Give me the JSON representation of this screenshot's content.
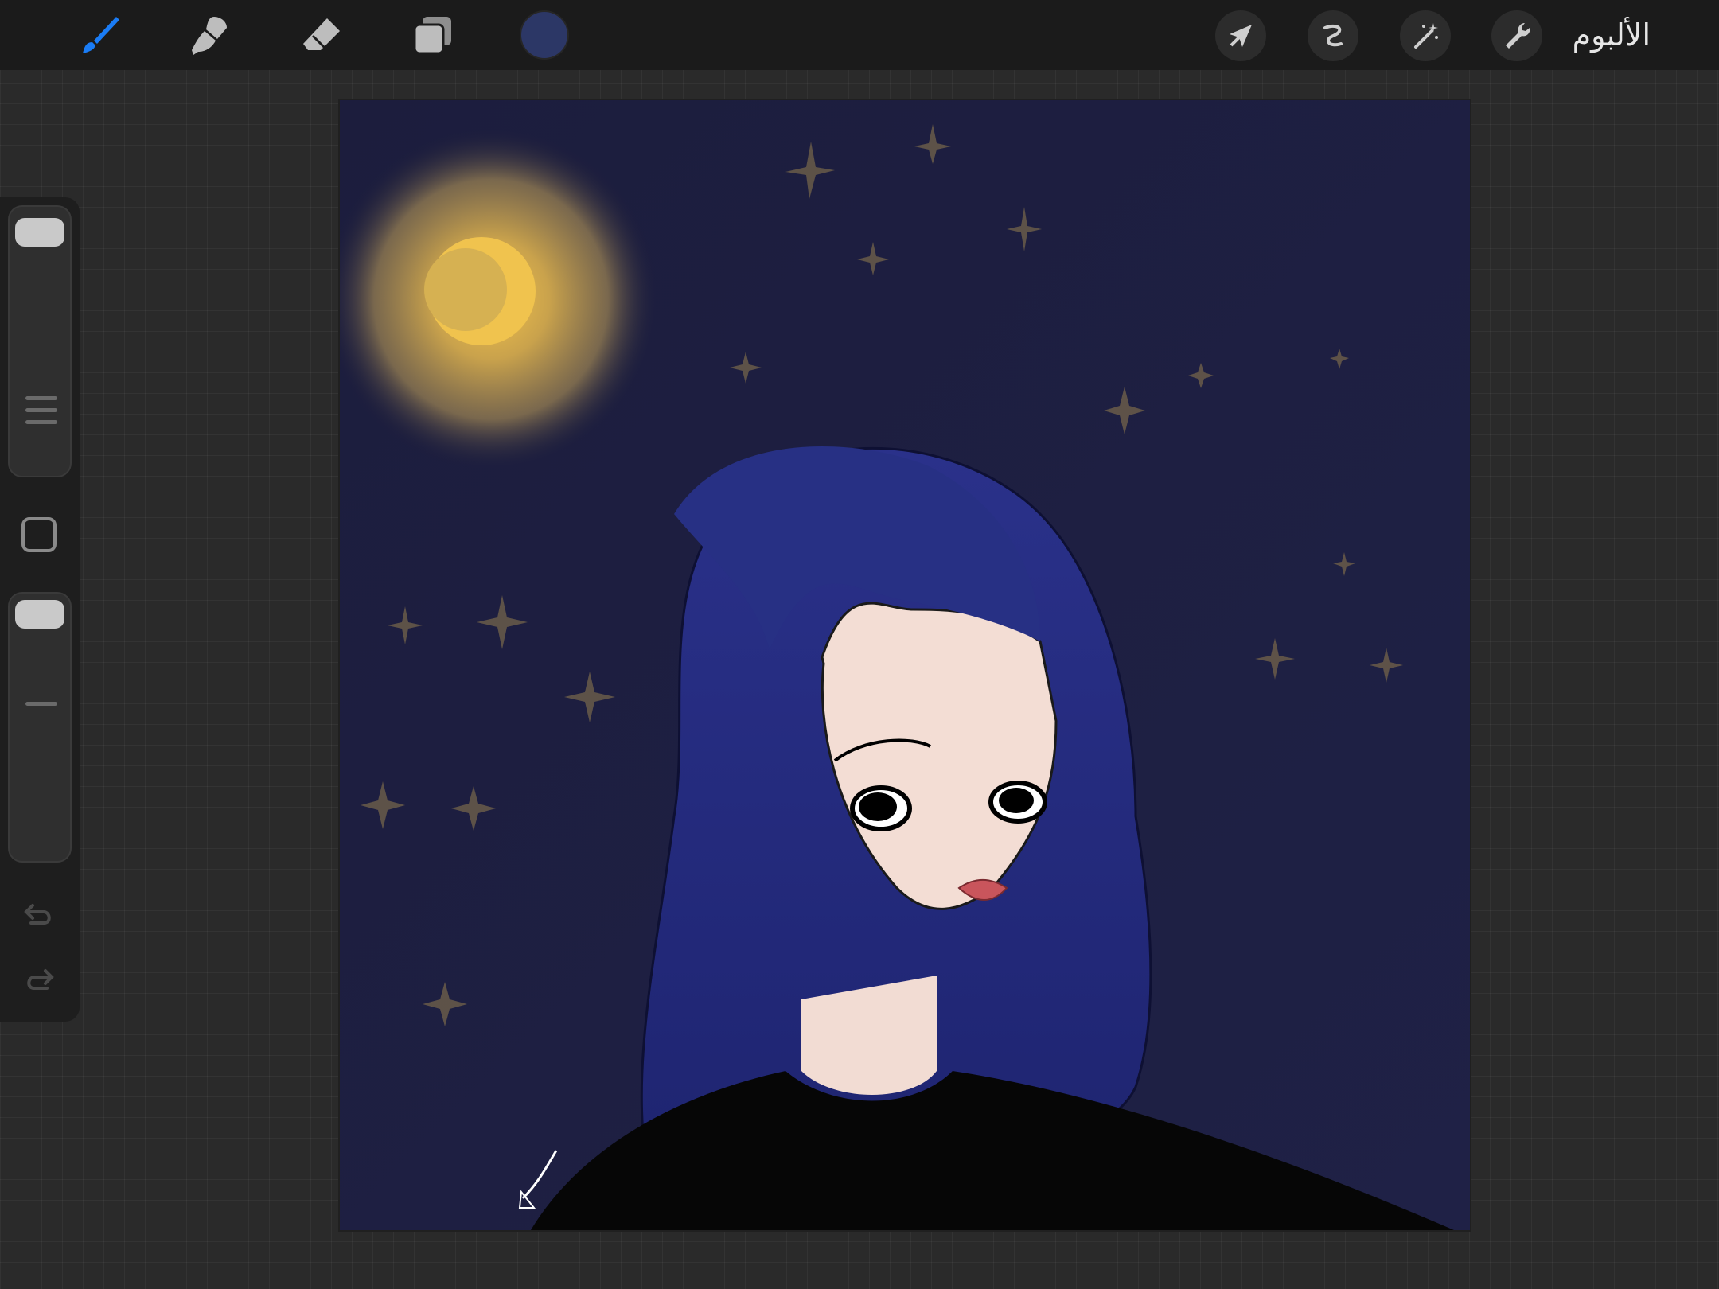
{
  "toolbar": {
    "left_tools": [
      {
        "icon": "paintbrush-icon",
        "active": true
      },
      {
        "icon": "smudge-icon",
        "active": false
      },
      {
        "icon": "eraser-icon",
        "active": false
      },
      {
        "icon": "layers-icon",
        "active": false
      }
    ],
    "current_color": "#2c3766",
    "right_tools": [
      "cursor-transform-icon",
      "selection-icon",
      "adjustments-wand-icon",
      "actions-wrench-icon"
    ],
    "gallery_label": "الألبوم"
  },
  "sidebar": {
    "brush_size_level": 0.0,
    "opacity_level": 0.0,
    "icons": [
      "modify-square-icon",
      "undo-icon",
      "redo-icon"
    ]
  },
  "colors": {
    "accent": "#1a7cf5",
    "background": "#2a2a2a",
    "topbar": "#1b1b1b"
  }
}
